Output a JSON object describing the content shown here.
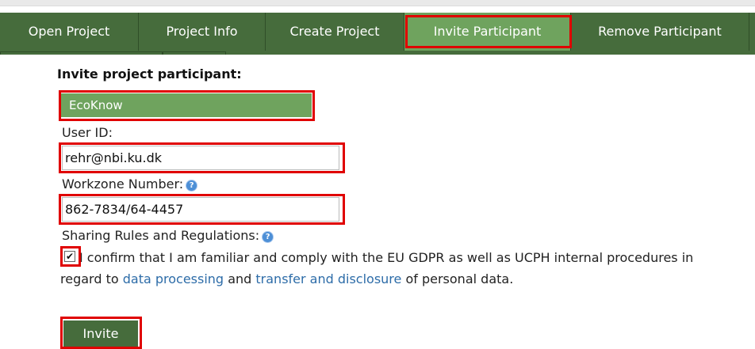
{
  "tabs": [
    {
      "label": "Open Project"
    },
    {
      "label": "Project Info"
    },
    {
      "label": "Create Project"
    },
    {
      "label": "Invite Participant",
      "active": true
    },
    {
      "label": "Remove Participant"
    }
  ],
  "form": {
    "heading": "Invite project participant:",
    "project_name": "EcoKnow",
    "user_id_label": "User ID:",
    "user_id_value": "rehr@nbi.ku.dk",
    "workzone_label": "Workzone Number:",
    "workzone_value": "862-7834/64-4457",
    "sharing_label": "Sharing Rules and Regulations:",
    "consent_checked": true,
    "consent_text_1": "I confirm that I am familiar and comply with the EU GDPR as well as UCPH internal procedures in regard to",
    "consent_link_1": "data processing",
    "consent_text_2": "and",
    "consent_link_2": "transfer and disclosure",
    "consent_text_3": "of personal data.",
    "invite_label": "Invite"
  },
  "icons": {
    "help": "help-icon",
    "check": "checkmark-icon"
  },
  "colors": {
    "tabbar": "#466c3c",
    "active_tab": "#6fa35e",
    "highlight": "#e00000",
    "link": "#2d6ca8"
  }
}
